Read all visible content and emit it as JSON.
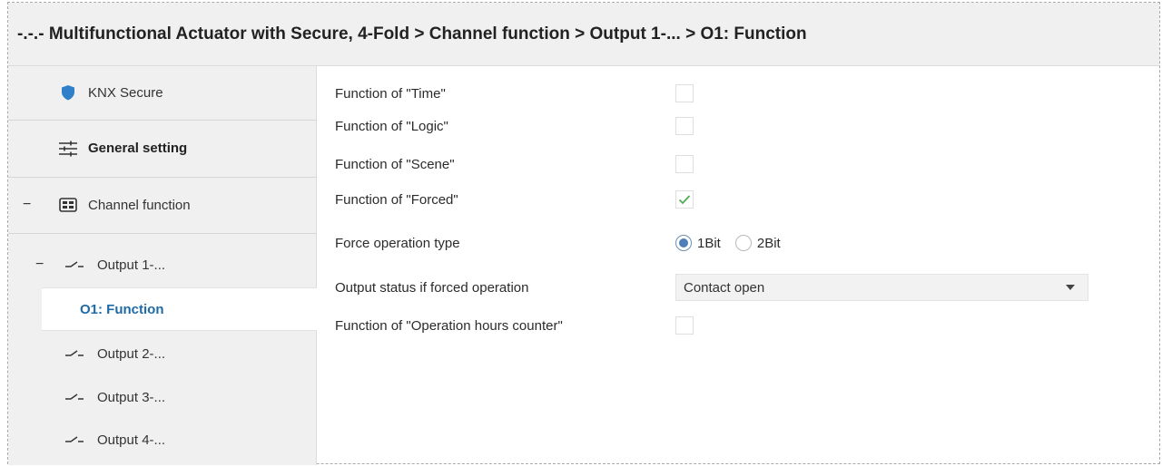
{
  "header": {
    "breadcrumb": "-.-.- Multifunctional Actuator with Secure, 4-Fold > Channel function > Output 1-... > O1: Function"
  },
  "sidebar": {
    "items": [
      {
        "label": "KNX Secure",
        "icon": "shield-icon"
      },
      {
        "label": "General setting",
        "icon": "sliders-icon"
      },
      {
        "label": "Channel function",
        "icon": "grid-icon",
        "expander": "−"
      },
      {
        "label": "Output 1-...",
        "icon": "switch-icon",
        "expander": "−"
      },
      {
        "label": "O1: Function"
      },
      {
        "label": "Output 2-...",
        "icon": "switch-icon"
      },
      {
        "label": "Output 3-...",
        "icon": "switch-icon"
      },
      {
        "label": "Output 4-...",
        "icon": "switch-icon"
      }
    ],
    "selected": "O1: Function"
  },
  "params": {
    "time": {
      "label": "Function of \"Time\"",
      "checked": false
    },
    "logic": {
      "label": "Function of \"Logic\"",
      "checked": false
    },
    "scene": {
      "label": "Function of \"Scene\"",
      "checked": false
    },
    "forced": {
      "label": "Function of \"Forced\"",
      "checked": true
    },
    "force_type": {
      "label": "Force operation type",
      "options": [
        "1Bit",
        "2Bit"
      ],
      "selected": "1Bit"
    },
    "output_status": {
      "label": "Output status if forced operation",
      "value": "Contact open"
    },
    "hours_counter": {
      "label": "Function of \"Operation hours counter\"",
      "checked": false
    }
  },
  "colors": {
    "shield": "#2f80c9",
    "selected_text": "#1e6aa6",
    "check": "#4caf50",
    "radio_dot": "#4e7fb9"
  }
}
